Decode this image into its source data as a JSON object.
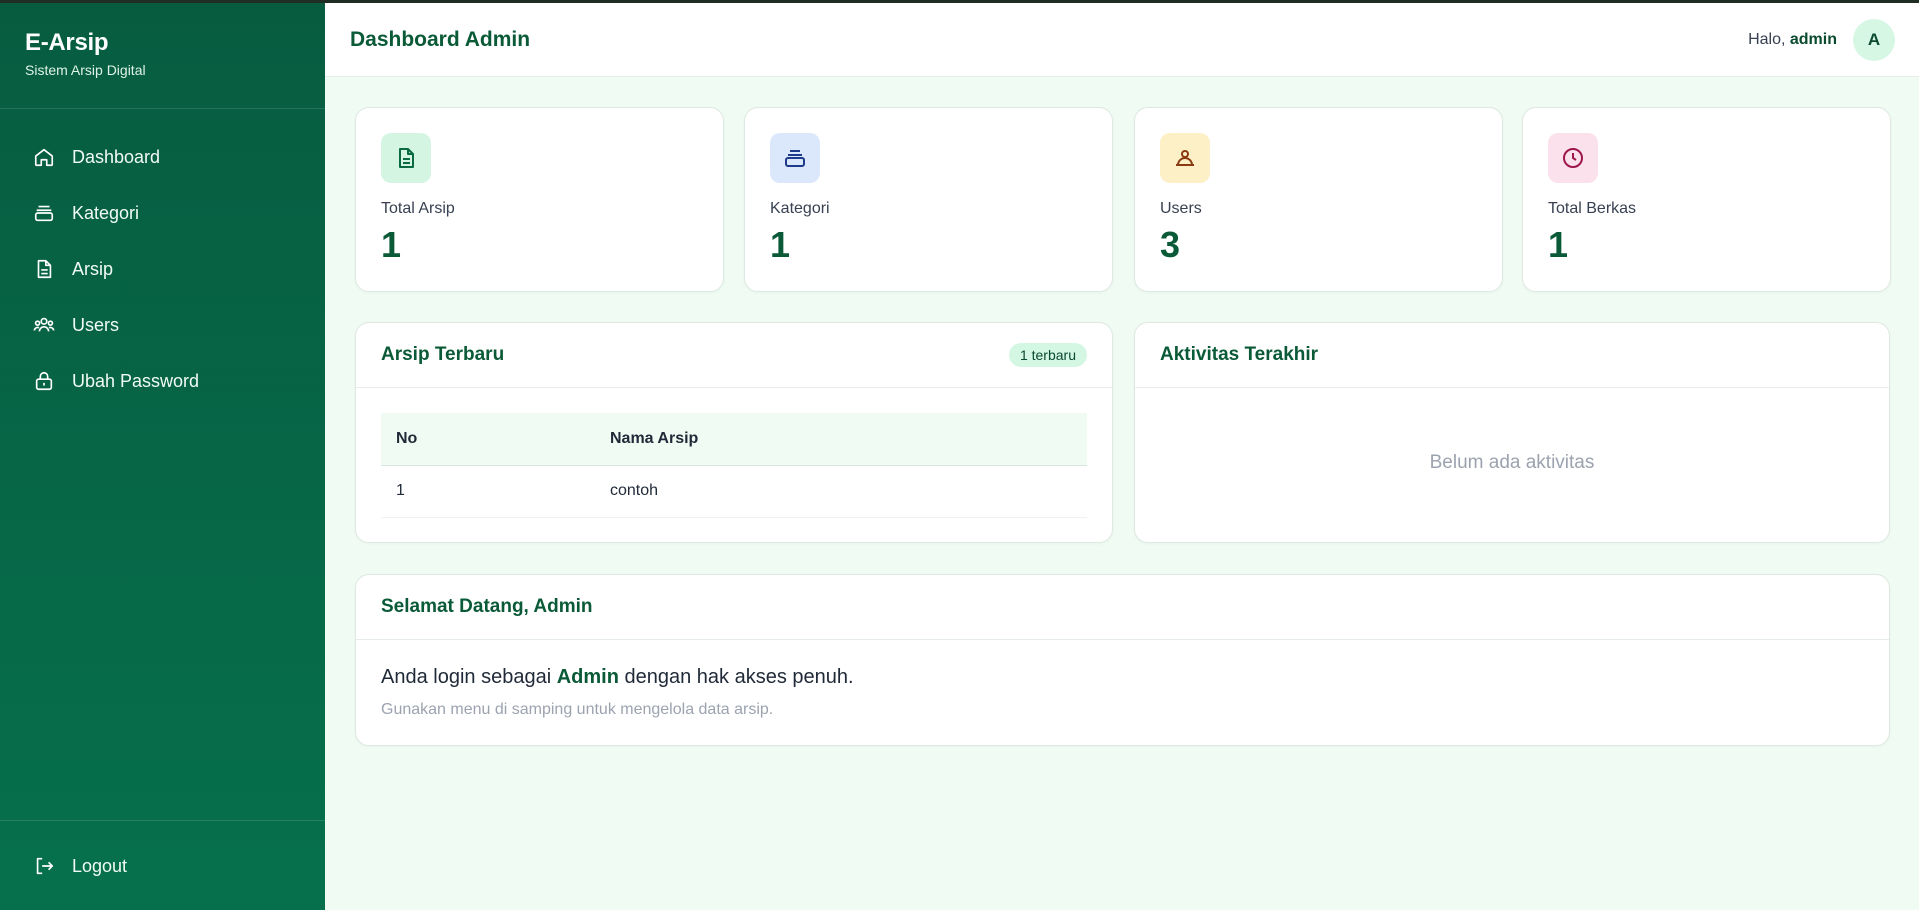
{
  "brand": {
    "title": "E-Arsip",
    "subtitle": "Sistem Arsip Digital"
  },
  "sidebar": {
    "items": [
      {
        "label": "Dashboard",
        "icon": "home-icon"
      },
      {
        "label": "Kategori",
        "icon": "layers-icon"
      },
      {
        "label": "Arsip",
        "icon": "document-icon"
      },
      {
        "label": "Users",
        "icon": "users-icon"
      },
      {
        "label": "Ubah Password",
        "icon": "lock-icon"
      }
    ],
    "logout": {
      "label": "Logout",
      "icon": "logout-icon"
    }
  },
  "header": {
    "title": "Dashboard Admin",
    "greeting_prefix": "Halo, ",
    "username": "admin",
    "avatar_initial": "A"
  },
  "stats": [
    {
      "label": "Total Arsip",
      "value": "1",
      "icon": "document-icon",
      "bg": "#d5f5e3",
      "color": "#0a6a40"
    },
    {
      "label": "Kategori",
      "value": "1",
      "icon": "layers-icon",
      "bg": "#dbe7fb",
      "color": "#1e3a8a"
    },
    {
      "label": "Users",
      "value": "3",
      "icon": "users-icon",
      "bg": "#fdf0c7",
      "color": "#8a3b12"
    },
    {
      "label": "Total Berkas",
      "value": "1",
      "icon": "clock-icon",
      "bg": "#fbe1ec",
      "color": "#9d174d"
    }
  ],
  "recent": {
    "title": "Arsip Terbaru",
    "badge": "1 terbaru",
    "columns": [
      "No",
      "Nama Arsip"
    ],
    "rows": [
      [
        "1",
        "contoh"
      ]
    ]
  },
  "activity": {
    "title": "Aktivitas Terakhir",
    "empty": "Belum ada aktivitas"
  },
  "welcome": {
    "title": "Selamat Datang, Admin",
    "line_prefix": "Anda login sebagai ",
    "role": "Admin",
    "line_suffix": " dengan hak akses penuh.",
    "hint": "Gunakan menu di samping untuk mengelola data arsip."
  },
  "colors": {
    "primary": "#065f46",
    "accent": "#0a5a37",
    "background": "#effbf3"
  }
}
